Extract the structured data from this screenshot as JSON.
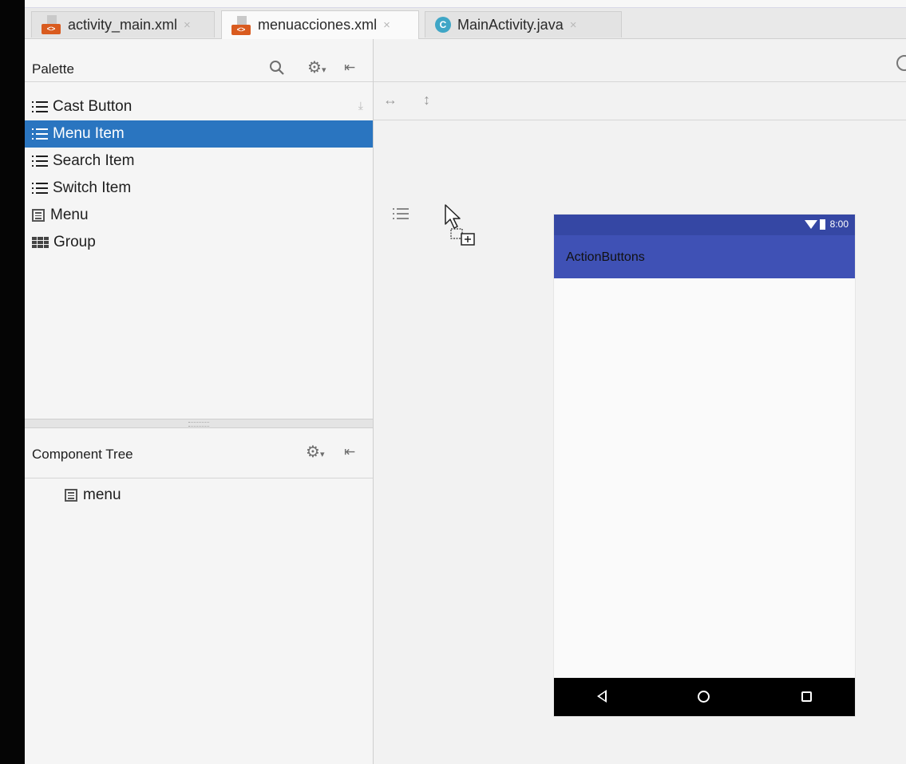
{
  "tabs": [
    {
      "label": "activity_main.xml",
      "icon": "xml-file-icon",
      "active": false
    },
    {
      "label": "menuacciones.xml",
      "icon": "xml-file-icon",
      "active": true
    },
    {
      "label": "MainActivity.java",
      "icon": "java-class-icon",
      "active": false
    }
  ],
  "tab_close_glyph": "×",
  "class_icon_letter": "C",
  "palette": {
    "title": "Palette",
    "items": [
      {
        "label": "Cast Button",
        "icon": "list-icon"
      },
      {
        "label": "Menu Item",
        "icon": "list-icon",
        "selected": true
      },
      {
        "label": "Search Item",
        "icon": "list-icon"
      },
      {
        "label": "Switch Item",
        "icon": "list-icon"
      },
      {
        "label": "Menu",
        "icon": "menu-icon"
      },
      {
        "label": "Group",
        "icon": "grid-icon"
      }
    ]
  },
  "component_tree": {
    "title": "Component Tree",
    "items": [
      {
        "label": "menu",
        "icon": "menu-icon"
      }
    ]
  },
  "device": {
    "status_time": "8:00",
    "app_title": "ActionButtons"
  },
  "colors": {
    "selection": "#2a75c0",
    "app_bar": "#3f51b5",
    "status_bar": "#3547a4",
    "xml_icon": "#d95b1f",
    "java_icon": "#3fa6c6"
  }
}
